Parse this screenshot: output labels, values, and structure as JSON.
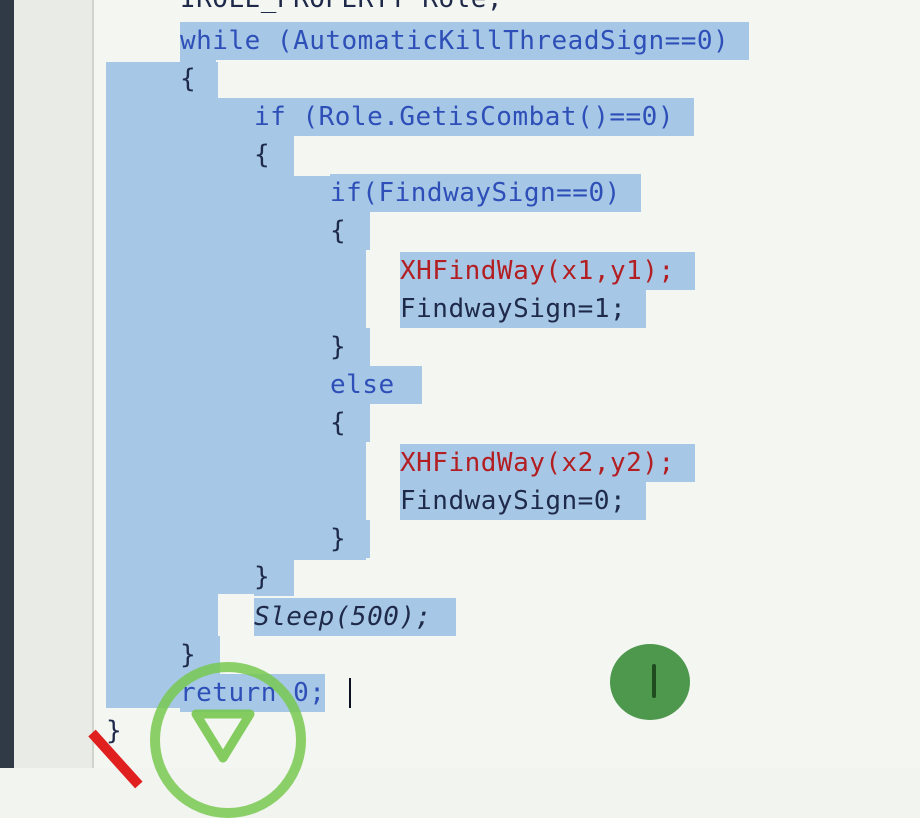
{
  "editor": {
    "code_lines": [
      "IROLE_PROPERTY Role;",
      "while (AutomaticKillThreadSign==0)",
      "{",
      "if (Role.GetisCombat()==0)",
      "{",
      "if(FindwaySign==0)",
      "{",
      "XHFindWay(x1,y1);",
      "FindwaySign=1;",
      "}",
      "else",
      "{",
      "XHFindWay(x2,y2);",
      "FindwaySign=0;",
      "}",
      "}",
      "Sleep(500);",
      "}",
      "return 0;",
      "}"
    ]
  },
  "colors": {
    "selection": "#a6c8e6",
    "keyword": "#2f4fb8",
    "function_call": "#b21e22",
    "text": "#1f2a4a"
  },
  "icons": {
    "cursor": "text-cursor-icon",
    "overlay_dot": "green-dot-icon",
    "overlay_ring": "green-ring-icon",
    "overlay_red": "red-mark-icon"
  }
}
